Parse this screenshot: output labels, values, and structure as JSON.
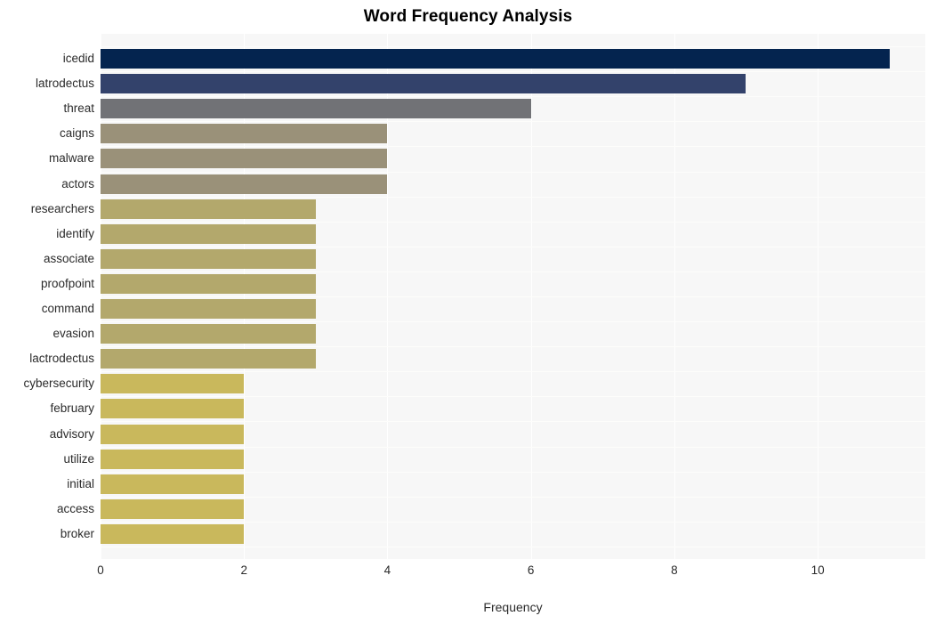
{
  "chart_data": {
    "type": "bar",
    "orientation": "horizontal",
    "title": "Word Frequency Analysis",
    "xlabel": "Frequency",
    "ylabel": "",
    "xlim": [
      0,
      11.5
    ],
    "xticks": [
      0,
      2,
      4,
      6,
      8,
      10
    ],
    "xtick_labels": [
      "0",
      "2",
      "4",
      "6",
      "8",
      "10"
    ],
    "grid": true,
    "legend": false,
    "categories": [
      "icedid",
      "latrodectus",
      "threat",
      "caigns",
      "malware",
      "actors",
      "researchers",
      "identify",
      "associate",
      "proofpoint",
      "command",
      "evasion",
      "lactrodectus",
      "cybersecurity",
      "february",
      "advisory",
      "utilize",
      "initial",
      "access",
      "broker"
    ],
    "values": [
      11,
      9,
      6,
      4,
      4,
      4,
      3,
      3,
      3,
      3,
      3,
      3,
      3,
      2,
      2,
      2,
      2,
      2,
      2,
      2
    ],
    "bar_colors": [
      "#04244f",
      "#33426b",
      "#717276",
      "#9a9179",
      "#9a9179",
      "#9a9179",
      "#b3a86c",
      "#b3a86c",
      "#b3a86c",
      "#b3a86c",
      "#b3a86c",
      "#b3a86c",
      "#b3a86c",
      "#c9b85c",
      "#c9b85c",
      "#c9b85c",
      "#c9b85c",
      "#c9b85c",
      "#c9b85c",
      "#c9b85c"
    ],
    "plot_background": "#f7f7f7",
    "figure_background": "#ffffff",
    "gridline_color": "#ffffff",
    "title_color": "#000000",
    "tick_label_color": "#2b2b2b"
  }
}
